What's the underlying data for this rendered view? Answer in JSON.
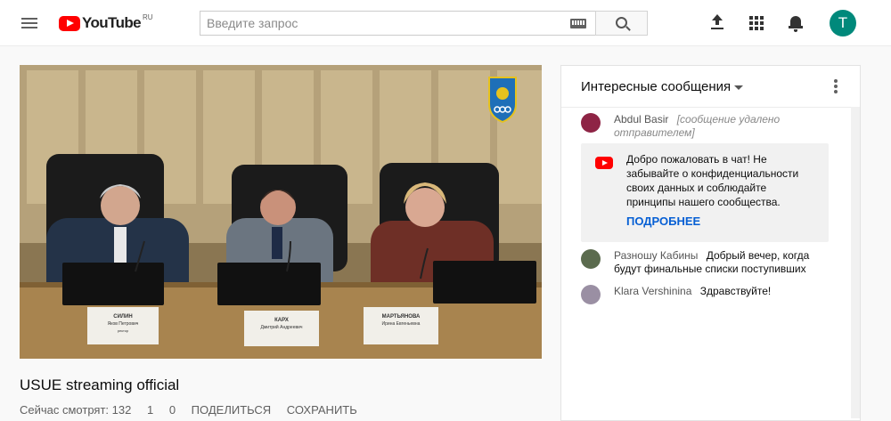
{
  "header": {
    "logo_text": "YouTube",
    "logo_region": "RU",
    "search_placeholder": "Введите запрос",
    "avatar_letter": "T",
    "avatar_color": "#00897b",
    "icons": [
      "menu-icon",
      "youtube-logo-icon",
      "keyboard-icon",
      "search-icon",
      "upload-icon",
      "apps-icon",
      "bell-icon"
    ]
  },
  "video": {
    "title": "USUE streaming official",
    "meta": [
      "Сейчас смотрят: 132",
      "1",
      "0",
      "ПОДЕЛИТЬСЯ",
      "СОХРАНИТЬ"
    ],
    "placards": [
      {
        "name": "СИЛИН",
        "sub": "Яков Петрович",
        "role": "ректор"
      },
      {
        "name": "КАРХ",
        "sub": "Дмитрий Андреевич",
        "role": ""
      },
      {
        "name": "МАРТЬЯНОВА",
        "sub": "Ирина Евгеньевна",
        "role": ""
      }
    ]
  },
  "chat": {
    "mode_label": "Интересные сообщения",
    "messages": [
      {
        "author": "Abdul Basir",
        "deleted_note": "[сообщение удалено отправителем]",
        "text": "",
        "avatar_color": "#8e2445"
      },
      {
        "author": "Разношу Кабины",
        "deleted_note": "",
        "text": "Добрый вечер, когда будут финальные списки поступивших",
        "avatar_color": "#5b6b4e"
      },
      {
        "author": "Klara Vershinina",
        "deleted_note": "",
        "text": "Здравствуйте!",
        "avatar_color": "#9a8fa3"
      }
    ],
    "notice": {
      "text": "Добро пожаловать в чат! Не забывайте о конфиденциальности своих данных и соблюдайте принципы нашего сообщества.",
      "link": "ПОДРОБНЕЕ"
    }
  }
}
